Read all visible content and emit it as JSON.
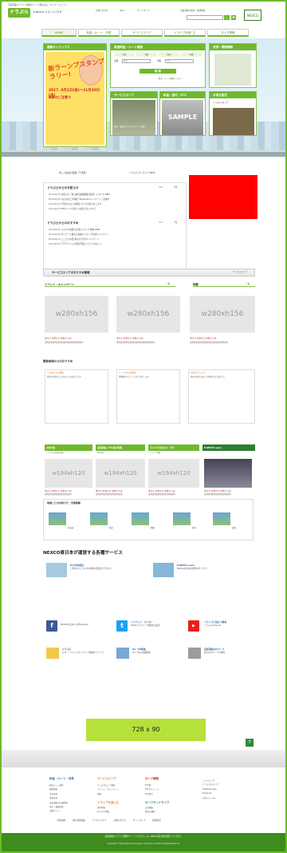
{
  "header": {
    "tagline": "高速道路のドライブ情報サイト 全国のお店・マップ・ニュース",
    "logo": "ドラぷら",
    "logo_sub": "E-NEXCO ドライブプラザ",
    "links": [
      "お問い合わせ",
      "Q&A",
      "サイトマップ",
      "高速道路の料金・交通情報"
    ],
    "search_placeholder": "",
    "search_icon": "search-icon",
    "gear_icon": "gear-icon",
    "corp_logo": "NEXCO"
  },
  "nav": [
    "HOME",
    "料金・ルート・渋滞",
    "サービスエリア",
    "ドライブを楽しむ",
    "おトク情報"
  ],
  "topics": {
    "heading": "最新のトピックス",
    "catch": "新ラーンプスタンプラリー!",
    "date": "2017. 9月1日(金)〜11月30日(水)",
    "sub": "新幹のご注意ラ"
  },
  "route_search": {
    "heading": "高速料金・ルート検索",
    "tabs": [
      "出発",
      "到着",
      "経由",
      "車種"
    ],
    "from_label": "出発",
    "from_placeholder": "地名",
    "to_label": "到着",
    "to_placeholder": "IC名",
    "button": "検 索",
    "note": "料金・ルート検索について"
  },
  "traffic": {
    "heading": "渋滞・規制情報"
  },
  "cards": [
    {
      "heading": "サービスエリア",
      "caption": "お店・施設からサービスエリアを探す"
    },
    {
      "heading": "料金・割引・ETC",
      "caption": "SAMPLE"
    },
    {
      "heading": "お得な割引",
      "caption": "ドラぷらスタンプ"
    }
  ],
  "ticker": [
    "新しい施設の開業（千葉県）",
    "ドラぷらでドライブ NEW"
  ],
  "news": {
    "heading1": "ドラぷらからのお知らせ",
    "rss_label": "RSS",
    "more_label": "一覧",
    "rows1": [
      {
        "date": "2014.06.30",
        "text": "お知らせ「東日本高速道路株式会社」について NEW"
      },
      {
        "date": "2014.06.30",
        "text": "今日のおとク情報「Presentsキャンペーン」実施中"
      },
      {
        "date": "2014.06.30",
        "text": "7月分のおとク情報についてお知らせします"
      },
      {
        "date": "2014.06.25",
        "text": "ETCカードの新しいお知らせについて"
      }
    ],
    "heading2": "ドラぷらからのおすすめ",
    "rows2": [
      {
        "date": "2014.06.30",
        "text": "とんかつ太郎の日替わりランチ特集 NEW"
      },
      {
        "date": "2014.06.30",
        "text": "ポッチーと旅する初夏のドライブ企画キャンペーン"
      },
      {
        "date": "2014.06.25",
        "text": "ここだけの話 夏のおでかけキャンペーン"
      },
      {
        "date": "2014.06.25",
        "text": "アクアラインの渋滞予測とドライブスポット"
      }
    ]
  },
  "sa_section": {
    "title": "サービスエリアのおすすめ情報",
    "link": "サービスエリア"
  },
  "events": {
    "heading1": "イベント・キャンペーン",
    "heading2": "特集",
    "more_label": "一覧",
    "items": [
      {
        "img": "w280xh156",
        "title": "タイトルタイトルタイトル",
        "desc": "説明説明説明説明説明説明説明説明説明説明"
      },
      {
        "img": "w280xh156",
        "title": "タイトルタイトルタイトル",
        "desc": "説明説明説明説明説明説明説明説明説明説明"
      },
      {
        "img": "w280xh156",
        "title": "タイトルタイトルタイトル",
        "desc": "説明説明説明説明説明説明説明説明説明説明"
      }
    ]
  },
  "regional": {
    "heading": "関東地域からのおすすめ",
    "items": [
      {
        "title": "うんめえもん特集",
        "desc": "各地の新鮮なうんめえもんを紹介します"
      },
      {
        "title": "ドリンクNew特集",
        "desc": "季節限定のドリンクをご紹介します"
      },
      {
        "title": "お出かけしよう!",
        "desc": "週末の遠出に役立つ情報をまとめました"
      }
    ]
  },
  "blocks": [
    {
      "heading": "お得な旅",
      "sub": "ドラぷらのお得な割引"
    },
    {
      "heading": "高速道路 / ETC割引特集",
      "sub": "ETC割引"
    },
    {
      "heading": "グルマでお出かけ・学び",
      "sub": "ドライブ特集"
    },
    {
      "heading": "E-NEXCO pass",
      "sub": ""
    }
  ],
  "block_items": [
    {
      "img": "w194xh120",
      "title": "タイトルタイトルタイトル",
      "desc": "説明説明説明説明説明説明説明"
    },
    {
      "img": "w194xh120",
      "title": "タイトルタイトルタイトル",
      "desc": "説明説明説明説明説明説明説明"
    },
    {
      "img": "w194xh120",
      "title": "タイトルタイトルタイトル",
      "desc": "説明説明説明説明説明説明説明"
    },
    {
      "img": "",
      "title": "タイトルタイトルタイトル",
      "desc": "説明説明説明説明説明説明説明"
    }
  ],
  "areas": {
    "heading": "地域ごとのお知らせ・渋滞情報",
    "items": [
      "北海道",
      "東北",
      "関東",
      "新潟",
      "長野"
    ]
  },
  "services": {
    "heading": "NEXCO東日本が運営する各種サービス",
    "items": [
      {
        "title": "ETC利用照会",
        "desc": "ご利用いただいたETC料金の照会ができます"
      },
      {
        "title": "E-NEXCO pass",
        "desc": "NEXCO東日本の便利なサービス"
      },
      {
        "title": "NEXCO東日本 公式Facebook",
        "desc": ""
      },
      {
        "title": "ハイウェイ・カンター",
        "desc": "Twitterでドライブ情報をお届け"
      },
      {
        "title": "ドライブに役立つ動画",
        "desc": "ドラぷらChannel"
      },
      {
        "title": "ドラぷら",
        "desc": "スマートフォンでもドライブ情報をチェック"
      },
      {
        "title": "SA・PA情報",
        "desc": "SA・PAの店舗情報"
      },
      {
        "title": "高速道路のICカード",
        "desc": "様々なICカードの情報"
      }
    ]
  },
  "ad": "728 x 90",
  "footer": {
    "col1_h": "料金・ルート・渋滞",
    "col1": [
      "料金ルート検索",
      "規制情報",
      "渋滞予測",
      "事故渋滞",
      "高速道路の交通情報",
      "天気・積雪情報",
      "道路カメラ",
      "通行止め情報"
    ],
    "col2_h": "サービスエリア",
    "col2": [
      "サービスエリア検索",
      "イベント・キャンペーン",
      "特集",
      "施設・サービス",
      "SA・PA情報",
      "ショップ"
    ],
    "col2b_h": "ドライブを楽しむ",
    "col2b": [
      "旅行特集",
      "おでかけ特集",
      "地域情報",
      "SNSでの情報発信"
    ],
    "col3_h": "おトク情報",
    "col3": [
      "ETC割",
      "ETCマイレージ",
      "ETC割引",
      "ETCカード",
      "旅の特典"
    ],
    "col3b_h": "セーフティドライブ",
    "col3b": [
      "安全運転",
      "雪道の運転",
      "事故の対処"
    ],
    "col4": [
      "ショッピング",
      "ドラぷらスタンプ",
      "E-NEXCO pass",
      "Facebook",
      "公式ツイッター",
      "ドラぷらChannel"
    ]
  },
  "bottom_links": [
    "利用規約",
    "個人情報保護",
    "リンクについて",
    "お問い合わせ",
    "サイトマップ",
    "推奨環境",
    "広告掲載について"
  ],
  "copyright1": "高速道路のドライブ情報サイト「ドラぷら」は、NEXCO東日本が運営しています。",
  "copyright2": "Copyright © East Nippon Expressway Company Limited All Rights Reserved."
}
